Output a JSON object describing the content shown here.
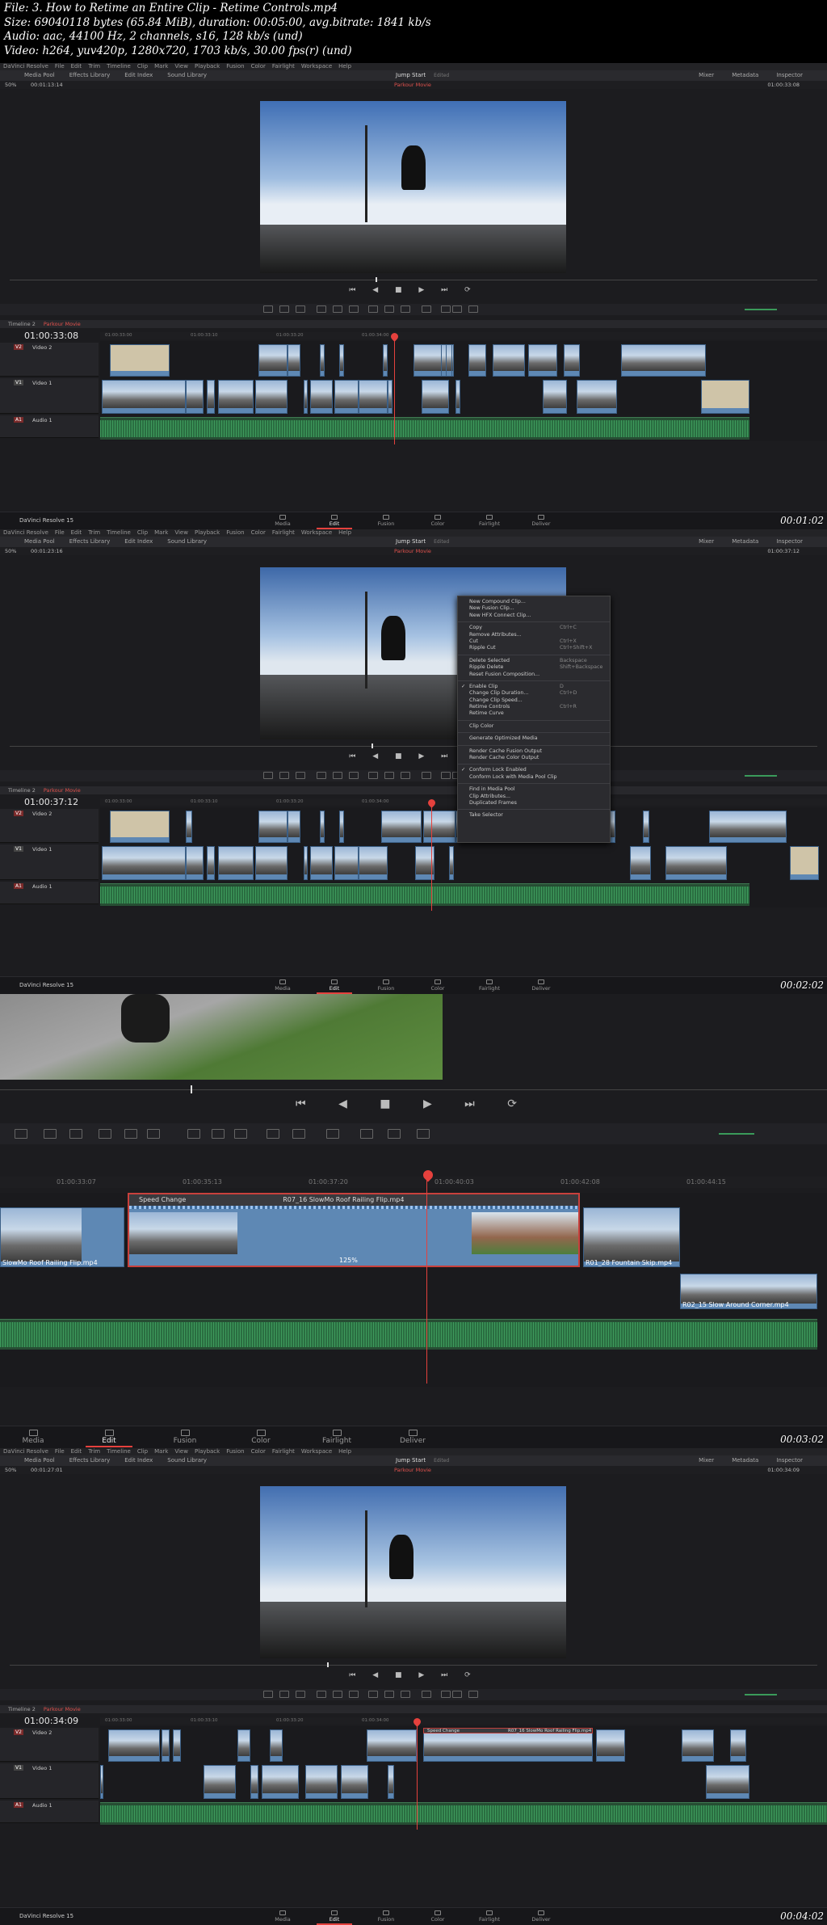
{
  "file_info": {
    "line1": "File: 3. How to Retime an Entire Clip - Retime Controls.mp4",
    "line2": "Size: 69040118 bytes (65.84 MiB), duration: 00:05:00, avg.bitrate: 1841 kb/s",
    "line3": "Audio: aac, 44100 Hz, 2 channels, s16, 128 kb/s (und)",
    "line4": "Video: h264, yuv420p, 1280x720, 1703 kb/s, 30.00 fps(r) (und)"
  },
  "menu": [
    "DaVinci Resolve",
    "File",
    "Edit",
    "Trim",
    "Timeline",
    "Clip",
    "Mark",
    "View",
    "Playback",
    "Fusion",
    "Color",
    "Fairlight",
    "Workspace",
    "Help"
  ],
  "toolbar": {
    "left": [
      "Media Pool",
      "Effects Library",
      "Edit Index",
      "Sound Library"
    ],
    "center": "Jump Start",
    "center_sub": "Edited",
    "right": [
      "Mixer",
      "Metadata",
      "Inspector"
    ]
  },
  "pages": [
    "Media",
    "Edit",
    "Fusion",
    "Color",
    "Fairlight",
    "Deliver"
  ],
  "brand": "DaVinci Resolve 15",
  "zoom_pct": "50%",
  "timeline_name": "Timeline 2",
  "timeline_tab": "Parkour Movie",
  "tracks": {
    "v2": "Video 2",
    "v1": "Video 1",
    "a1": "Audio 1",
    "v2_id": "V2",
    "v1_id": "V1",
    "a1_id": "A1"
  },
  "frames": [
    {
      "tc_left": "00:01:13:14",
      "tc_right": "01:00:33:08",
      "tc_big": "01:00:33:08",
      "stamp": "00:01:02"
    },
    {
      "tc_left": "00:01:23:16",
      "tc_right": "01:00:37:12",
      "tc_big": "01:00:37:12",
      "stamp": "00:02:02"
    },
    {
      "stamp": "00:03:02"
    },
    {
      "tc_left": "00:01:27:01",
      "tc_right": "01:00:34:09",
      "tc_big": "01:00:34:09",
      "stamp": "00:04:02"
    }
  ],
  "ruler_ticks": [
    "01:00:33:00",
    "01:00:33:10",
    "01:00:33:20",
    "01:00:34:00"
  ],
  "ctx_menu": [
    {
      "label": "New Compound Clip..."
    },
    {
      "label": "New Fusion Clip..."
    },
    {
      "label": "New HFX Connect Clip..."
    },
    {
      "sep": true
    },
    {
      "label": "Copy",
      "sc": "Ctrl+C"
    },
    {
      "label": "Remove Attributes..."
    },
    {
      "label": "Cut",
      "sc": "Ctrl+X"
    },
    {
      "label": "Ripple Cut",
      "sc": "Ctrl+Shift+X"
    },
    {
      "sep": true
    },
    {
      "label": "Delete Selected",
      "sc": "Backspace"
    },
    {
      "label": "Ripple Delete",
      "sc": "Shift+Backspace"
    },
    {
      "label": "Reset Fusion Composition..."
    },
    {
      "sep": true
    },
    {
      "label": "Enable Clip",
      "sc": "D",
      "chk": true
    },
    {
      "label": "Change Clip Duration...",
      "sc": "Ctrl+D"
    },
    {
      "label": "Change Clip Speed..."
    },
    {
      "label": "Retime Controls",
      "sc": "Ctrl+R"
    },
    {
      "label": "Retime Curve"
    },
    {
      "sep": true
    },
    {
      "label": "Clip Color"
    },
    {
      "sep": true
    },
    {
      "label": "Generate Optimized Media"
    },
    {
      "sep": true
    },
    {
      "label": "Render Cache Fusion Output"
    },
    {
      "label": "Render Cache Color Output"
    },
    {
      "sep": true
    },
    {
      "label": "Conform Lock Enabled",
      "chk": true
    },
    {
      "label": "Conform Lock with Media Pool Clip"
    },
    {
      "sep": true
    },
    {
      "label": "Find in Media Pool"
    },
    {
      "label": "Clip Attributes..."
    },
    {
      "label": "Duplicated Frames"
    },
    {
      "sep": true
    },
    {
      "label": "Take Selector"
    }
  ],
  "zoom_view": {
    "ruler": [
      "01:00:33:07",
      "01:00:35:13",
      "01:00:37:20",
      "01:00:40:03",
      "01:00:42:08",
      "01:00:44:15"
    ],
    "speed_label": "Speed Change",
    "clip_main": "R07_16 SlowMo Roof Railing Flip.mp4",
    "clip_left": "SlowMo Roof Railing Flip.mp4",
    "clip_right": "R01_28 Fountain Skip.mp4",
    "clip_lower": "R02_15 Slow Around Corner.mp4",
    "speed_pct": "125%"
  },
  "frame4_clip": {
    "speed_label": "Speed Change",
    "name": "R07_16 SlowMo Roof Railing Flip.mp4"
  }
}
